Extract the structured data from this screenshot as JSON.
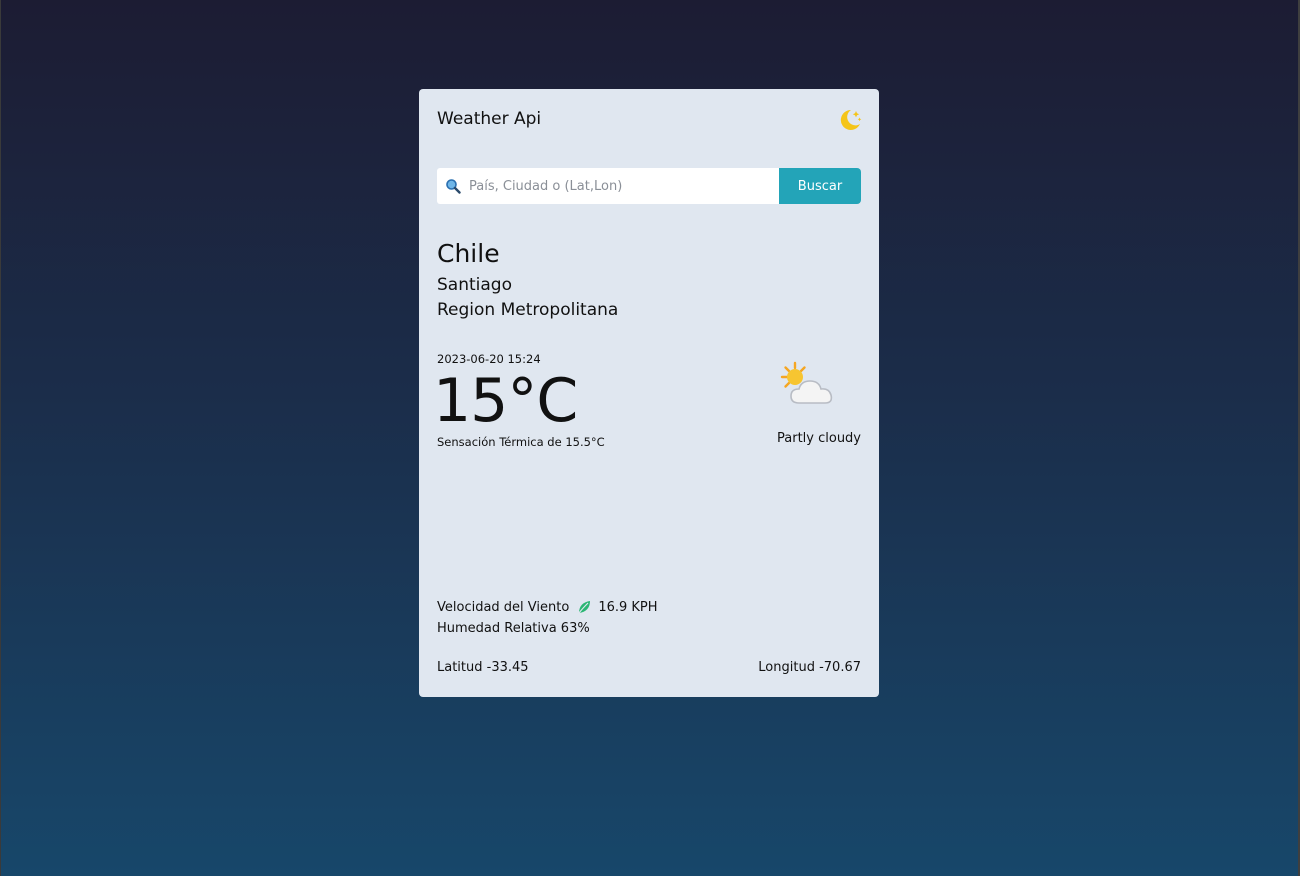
{
  "app": {
    "title": "Weather Api",
    "theme_icon": "moon-stars-icon"
  },
  "search": {
    "placeholder": "País, Ciudad o (Lat,Lon)",
    "value": "",
    "button_label": "Buscar",
    "icon": "search-icon"
  },
  "location": {
    "country": "Chile",
    "city": "Santiago",
    "region": "Region Metropolitana"
  },
  "current": {
    "datetime": "2023-06-20 15:24",
    "temperature": "15°C",
    "feels_like": "Sensación Térmica de 15.5°C",
    "condition": "Partly cloudy",
    "condition_icon": "partly-cloudy-icon"
  },
  "details": {
    "wind_label": "Velocidad del Viento",
    "wind_icon": "leaf-icon",
    "wind_value": "16.9 KPH",
    "humidity": "Humedad Relativa 63%",
    "latitude": "Latitud -33.45",
    "longitude": "Longitud -70.67"
  },
  "colors": {
    "accent": "#23a4b8",
    "card": "#e0e7f0",
    "moon": "#f5c518",
    "leaf": "#2bb673"
  }
}
